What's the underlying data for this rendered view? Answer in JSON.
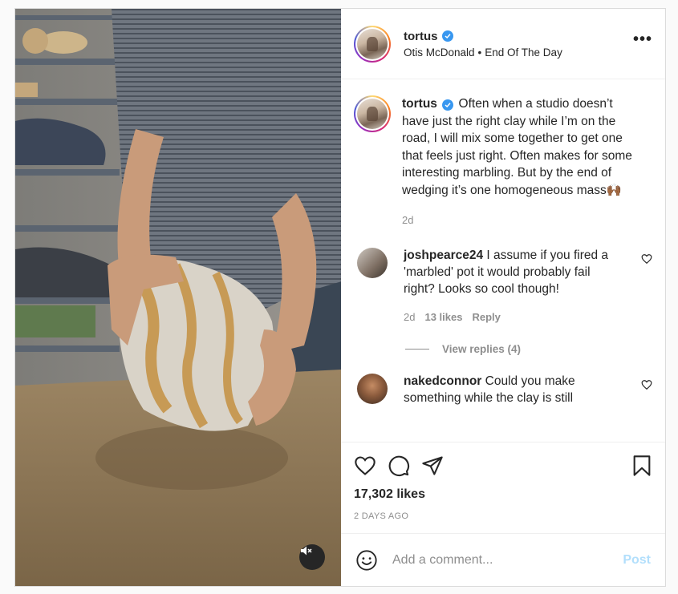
{
  "post": {
    "username": "tortus",
    "verified": true,
    "location": "Otis McDonald",
    "separator": "•",
    "audio": "End Of The Day",
    "more_label": "•••"
  },
  "caption": {
    "username": "tortus",
    "text": "Often when a studio doesn’t have just the right clay while I’m on the road, I will mix some together to get one that feels just right. Often makes for some interesting marbling. But by the end of wedging it’s one homogeneous mass",
    "emoji": "🙌🏾",
    "age": "2d"
  },
  "comments": [
    {
      "username": "joshpearce24",
      "text": "I assume if you fired a 'marbled' pot it would probably fail right? Looks so cool though!",
      "age": "2d",
      "likes": "13 likes",
      "reply": "Reply",
      "view_replies": "View replies (4)"
    },
    {
      "username": "nakedconnor",
      "text": "Could you make something while the clay is still"
    }
  ],
  "stats": {
    "likes": "17,302 likes",
    "posted": "2 DAYS AGO"
  },
  "composer": {
    "placeholder": "Add a comment...",
    "post_label": "Post",
    "post_color": "#b2dffc"
  },
  "icons": {
    "verified": "verified-badge-icon",
    "like": "heart-icon",
    "comment": "comment-bubble-icon",
    "share": "paper-plane-icon",
    "save": "bookmark-icon",
    "emoji": "smiley-icon",
    "mute": "speaker-muted-icon"
  },
  "colors": {
    "verified": "#3897f0",
    "muted_text": "#8e8e8e",
    "border": "#dbdbdb"
  }
}
